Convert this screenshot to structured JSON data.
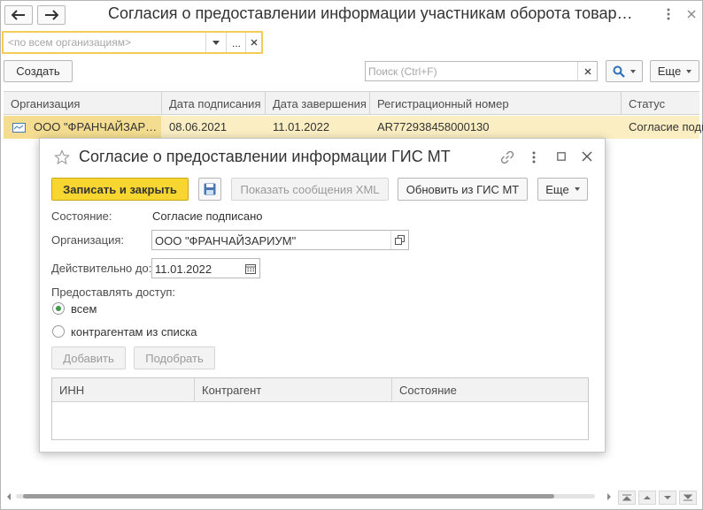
{
  "window": {
    "title": "Согласия о предоставлении информации участникам оборота товар…"
  },
  "filter": {
    "placeholder": "<по всем организациям>",
    "ellipsis": "..."
  },
  "toolbar": {
    "create_label": "Создать",
    "search_placeholder": "Поиск (Ctrl+F)",
    "more_label": "Еще"
  },
  "list": {
    "columns": [
      "Организация",
      "Дата подписания",
      "Дата завершения",
      "Регистрационный номер",
      "Статус"
    ],
    "rows": [
      {
        "organization": "ООО \"ФРАНЧАЙЗАР…",
        "signed": "08.06.2021",
        "ends": "11.01.2022",
        "reg_number": "AR772938458000130",
        "status": "Согласие подп"
      }
    ]
  },
  "dialog": {
    "title": "Согласие о предоставлении информации ГИС МТ",
    "buttons": {
      "save_close": "Записать и закрыть",
      "show_xml": "Показать сообщения XML",
      "update": "Обновить из ГИС МТ",
      "more": "Еще"
    },
    "state_label": "Состояние:",
    "state_value": "Согласие подписано",
    "org_label": "Организация:",
    "org_value": "ООО \"ФРАНЧАЙЗАРИУМ\"",
    "valid_label": "Действительно до:",
    "valid_value": "11.01.2022",
    "access_label": "Предоставлять доступ:",
    "radio_all": "всем",
    "radio_list": "контрагентам из списка",
    "add_label": "Добавить",
    "pick_label": "Подобрать",
    "columns": [
      "ИНН",
      "Контрагент",
      "Состояние"
    ]
  },
  "colors": {
    "accent_yellow": "#f7d631",
    "row_highlight": "#fbeec3",
    "selected_cell": "#f4dd90",
    "filter_border": "#f2cc57",
    "search_blue": "#2f6fb8"
  }
}
